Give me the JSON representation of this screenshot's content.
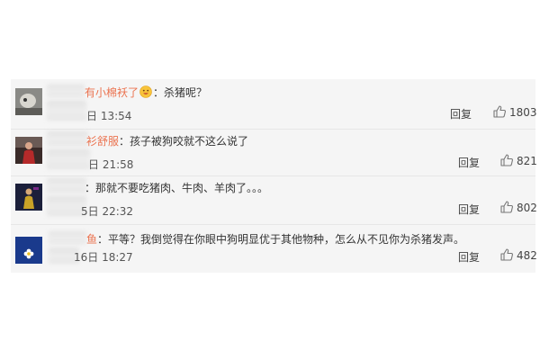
{
  "comments": [
    {
      "username": "有小棉袄了",
      "emoji_icon": "smiling-face-emoji-icon",
      "content": "：杀猪呢？",
      "time": "日 13:54",
      "reply_label": "回复",
      "likes": "1803",
      "avatar_icon": "gray-photo-avatar"
    },
    {
      "username": "衫舒服",
      "content": "：孩子被狗咬就不这么说了",
      "time": "日 21:58",
      "reply_label": "回复",
      "likes": "821",
      "avatar_icon": "red-figure-avatar"
    },
    {
      "username": "",
      "content": "：那就不要吃猪肉、牛肉、羊肉了。。。",
      "time": "5日 22:32",
      "reply_label": "回复",
      "likes": "802",
      "avatar_icon": "dark-figure-avatar"
    },
    {
      "username": "鱼",
      "content": "：平等？我倒觉得在你眼中狗明显优于其他物种，怎么从不见你为杀猪发声。",
      "time": "16日 18:27",
      "reply_label": "回复",
      "likes": "482",
      "avatar_icon": "blue-flower-avatar"
    }
  ],
  "colors": {
    "panel_bg": "#f5f5f5",
    "username": "#eb7350",
    "text": "#333333",
    "meta": "#555555"
  }
}
